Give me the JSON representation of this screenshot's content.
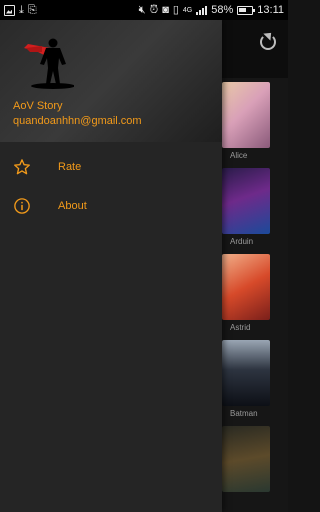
{
  "status_bar": {
    "battery_percent": "58%",
    "time": "13:11",
    "network_label": "4G",
    "left_icons": [
      "image-icon",
      "download-icon",
      "clipboard-icon"
    ],
    "right_icons": [
      "mute-icon",
      "alarm-icon",
      "nfc-icon",
      "vibrate-icon",
      "signal-icon",
      "battery-icon"
    ]
  },
  "drawer": {
    "account": {
      "name": "AoV Story",
      "email": "quandoanhhn@gmail.com",
      "avatar_icon": "superhero-silhouette-icon"
    },
    "menu": [
      {
        "label": "Rate",
        "icon": "star-outline-icon"
      },
      {
        "label": "About",
        "icon": "info-circle-icon"
      }
    ],
    "accent_color": "#f29a1a"
  },
  "background_app": {
    "toolbar_action_icon": "refresh-icon",
    "heroes": [
      {
        "name": "Alice"
      },
      {
        "name": "Arduin"
      },
      {
        "name": "Astrid"
      },
      {
        "name": "Batman"
      },
      {
        "name": ""
      }
    ]
  }
}
